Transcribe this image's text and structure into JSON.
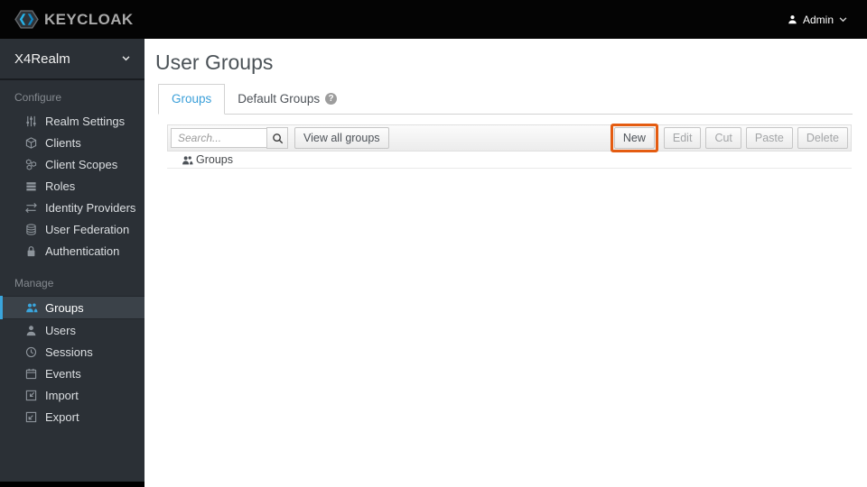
{
  "topbar": {
    "brand": "KEYCLOAK",
    "user_menu": {
      "label": "Admin",
      "icon": "user-icon",
      "caret": "chevron-down-icon"
    }
  },
  "sidebar": {
    "realm_selector": {
      "label": "X4Realm",
      "caret": "chevron-down-icon"
    },
    "sections": [
      {
        "label": "Configure",
        "items": [
          {
            "label": "Realm Settings",
            "icon": "sliders-icon",
            "active": false
          },
          {
            "label": "Clients",
            "icon": "cube-icon",
            "active": false
          },
          {
            "label": "Client Scopes",
            "icon": "cubes-icon",
            "active": false
          },
          {
            "label": "Roles",
            "icon": "layers-icon",
            "active": false
          },
          {
            "label": "Identity Providers",
            "icon": "exchange-arrows-icon",
            "active": false
          },
          {
            "label": "User Federation",
            "icon": "database-icon",
            "active": false
          },
          {
            "label": "Authentication",
            "icon": "lock-icon",
            "active": false
          }
        ]
      },
      {
        "label": "Manage",
        "items": [
          {
            "label": "Groups",
            "icon": "users-icon",
            "active": true
          },
          {
            "label": "Users",
            "icon": "user-icon",
            "active": false
          },
          {
            "label": "Sessions",
            "icon": "clock-icon",
            "active": false
          },
          {
            "label": "Events",
            "icon": "calendar-icon",
            "active": false
          },
          {
            "label": "Import",
            "icon": "import-icon",
            "active": false
          },
          {
            "label": "Export",
            "icon": "export-icon",
            "active": false
          }
        ]
      }
    ]
  },
  "main": {
    "title": "User Groups",
    "tabs": [
      {
        "label": "Groups",
        "active": true
      },
      {
        "label": "Default Groups",
        "active": false,
        "help_icon": "question-circle-icon"
      }
    ],
    "toolbar": {
      "search": {
        "placeholder": "Search...",
        "value": ""
      },
      "search_button_icon": "search-icon",
      "view_all_label": "View all groups",
      "actions": [
        {
          "label": "New",
          "enabled": true,
          "highlighted": true
        },
        {
          "label": "Edit",
          "enabled": false
        },
        {
          "label": "Cut",
          "enabled": false
        },
        {
          "label": "Paste",
          "enabled": false
        },
        {
          "label": "Delete",
          "enabled": false
        }
      ]
    },
    "tree": {
      "root": {
        "label": "Groups",
        "icon": "users-icon"
      }
    }
  },
  "icons": {
    "help_glyph": "?"
  },
  "colors": {
    "topbar_bg": "#040404",
    "sidebar_bg": "#2b3036",
    "sidebar_active_bg": "#3b4249",
    "accent_blue": "#3aa5dc",
    "tab_active_blue": "#3a9fd9",
    "annotation_orange": "#e45c11"
  }
}
